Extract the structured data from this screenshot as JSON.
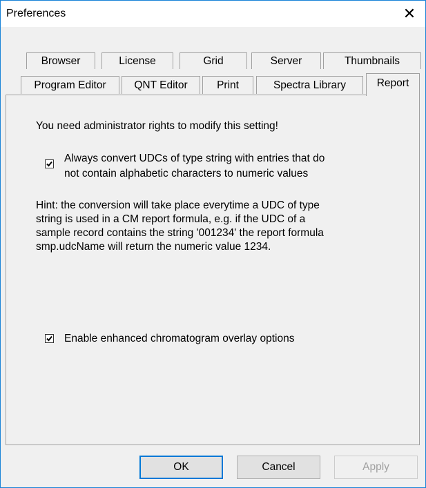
{
  "window": {
    "title": "Preferences",
    "close_glyph": "✕"
  },
  "tabs": {
    "row1": [
      {
        "label": "Browser"
      },
      {
        "label": "License"
      },
      {
        "label": "Grid"
      },
      {
        "label": "Server"
      },
      {
        "label": "Thumbnails"
      }
    ],
    "row2": [
      {
        "label": "Program Editor"
      },
      {
        "label": "QNT Editor"
      },
      {
        "label": "Print"
      },
      {
        "label": "Spectra Library"
      },
      {
        "label": "Report",
        "active": true
      }
    ]
  },
  "report": {
    "notice": "You need administrator rights to modify this setting!",
    "convert_udcs": {
      "checked": true,
      "label_line1": "Always convert UDCs of type string with entries that do",
      "label_line2": "not contain alphabetic characters to numeric values"
    },
    "hint_lines": [
      "Hint: the conversion will take place everytime a UDC of type",
      "string is used in a CM report formula, e.g. if the UDC of a",
      "sample record contains the string '001234' the report formula",
      "smp.udcName will return the numeric value 1234."
    ],
    "overlay_options": {
      "checked": true,
      "label": "Enable enhanced chromatogram overlay options"
    }
  },
  "buttons": {
    "ok": "OK",
    "cancel": "Cancel",
    "apply": "Apply"
  }
}
